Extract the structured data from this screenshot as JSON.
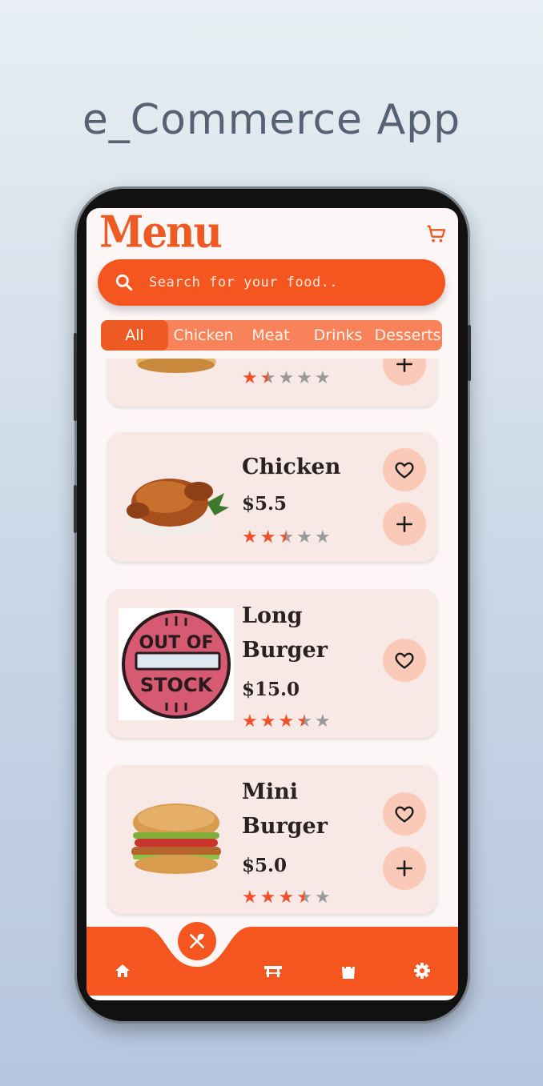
{
  "promo": {
    "title": "e_Commerce App"
  },
  "app": {
    "title": "Menu"
  },
  "search": {
    "placeholder": "Search for your food.."
  },
  "categories": [
    {
      "label": "All",
      "active": true
    },
    {
      "label": "Chicken",
      "active": false
    },
    {
      "label": "Meat",
      "active": false
    },
    {
      "label": "Drinks",
      "active": false
    },
    {
      "label": "Desserts",
      "active": false
    }
  ],
  "items": [
    {
      "name": "",
      "price": "",
      "rating": 1.5,
      "image": "burger-icon"
    },
    {
      "name": "Chicken",
      "price": "$5.5",
      "rating": 2.5,
      "image": "roast-chicken-icon"
    },
    {
      "name": "Long Burger",
      "name_line1": "Long",
      "name_line2": "Burger",
      "price": "$15.0",
      "rating": 3.5,
      "image": "out-of-stock-icon",
      "stamp_line1": "OUT OF",
      "stamp_line2": "STOCK"
    },
    {
      "name": "Mini Burger",
      "name_line1": "Mini",
      "name_line2": "Burger",
      "price": "$5.0",
      "rating": 3.5,
      "image": "burger-icon"
    }
  ],
  "nav": [
    "home-icon",
    "food-icon",
    "table-icon",
    "bag-icon",
    "settings-icon"
  ],
  "colors": {
    "accent": "#f5561f",
    "accent_light": "#fbc9b7",
    "card": "#f8e9e6",
    "star": "#f0512a"
  }
}
